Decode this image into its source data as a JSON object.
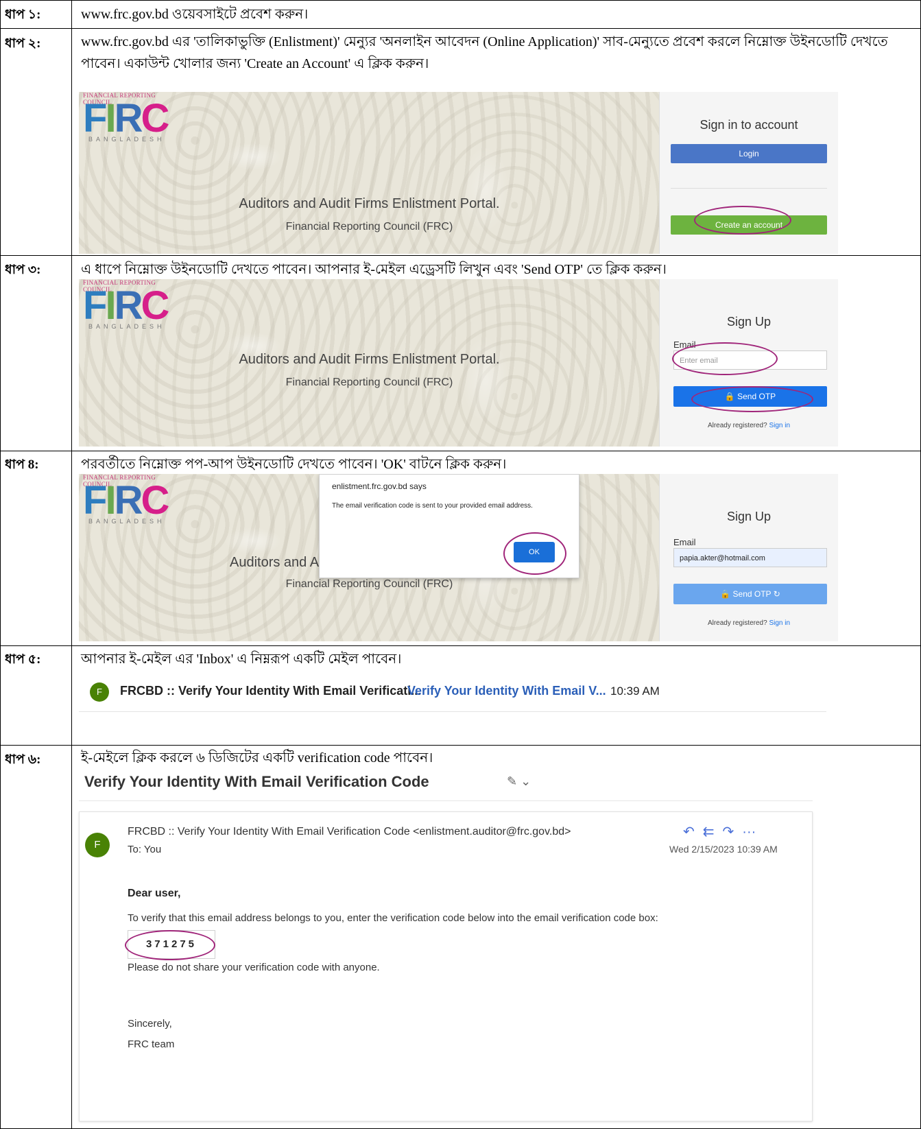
{
  "steps": [
    {
      "label": "ধাপ ১:",
      "text": "www.frc.gov.bd ওয়েবসাইটে প্রবেশ করুন।"
    },
    {
      "label": "ধাপ ২:",
      "text": "www.frc.gov.bd এর 'তালিকাভুক্তি (Enlistment)' মেন্যুর 'অনলাইন আবেদন (Online Application)' সাব-মেন্যুতে প্রবেশ করলে নিম্নোক্ত উইনডোটি দেখতে পাবেন। একাউন্ট খোলার জন্য 'Create an Account' এ ক্লিক করুন।"
    },
    {
      "label": "ধাপ ৩:",
      "text": "এ ধাপে নিম্নোক্ত উইনডোটি দেখতে পাবেন। আপনার ই-মেইল এড্রেসটি লিখুন এবং 'Send OTP' তে ক্লিক করুন।"
    },
    {
      "label": "ধাপ 8:",
      "text": "পরবর্তীতে নিম্নোক্ত পপ-আপ উইনডোটি দেখতে পাবেন। 'OK' বাটনে ক্লিক করুন।"
    },
    {
      "label": "ধাপ ৫:",
      "text": "আপনার ই-মেইল এর 'Inbox' এ নিম্নরূপ একটি মেইল পাবেন।"
    },
    {
      "label": "ধাপ ৬:",
      "text": "ই-মেইলে ক্লিক করলে ৬ ডিজিটের একটি verification code পাবেন।"
    }
  ],
  "logo": {
    "top_text": "FINANCIAL REPORTING COUNCIL",
    "mark": "FRC",
    "bottom_text": "BANGLADESH"
  },
  "portal": {
    "title": "Auditors and Audit Firms Enlistment Portal.",
    "title_cut": "Auditors and Aud",
    "subtitle": "Financial Reporting Council (FRC)",
    "signin_heading": "Sign in to account",
    "login_label": "Login",
    "create_label": "Create an account",
    "signup_heading": "Sign Up",
    "email_label": "Email",
    "email_placeholder": "Enter email",
    "email_value": "papia.akter@hotmail.com",
    "send_otp_label": "Send OTP",
    "already_text": "Already registered?",
    "signin_link": "Sign in"
  },
  "dialog": {
    "origin": "enlistment.frc.gov.bd says",
    "message": "The email verification code is sent to your provided email address.",
    "ok_label": "OK"
  },
  "inbox": {
    "avatar": "F",
    "sender_subject": "FRCBD :: Verify Your Identity With Email Verificati...",
    "preview": "Verify Your Identity With Email V...",
    "time": "10:39 AM"
  },
  "email": {
    "subject": "Verify Your Identity With Email Verification Code",
    "avatar": "F",
    "from": "FRCBD :: Verify Your Identity With Email Verification Code <enlistment.auditor@frc.gov.bd>",
    "to": "To:  You",
    "datetime": "Wed 2/15/2023 10:39 AM",
    "greeting": "Dear user,",
    "body1": "To verify that this email address belongs to you, enter the verification code below into the email verification code box:",
    "code": "371275",
    "body2": "Please do not share your verification code with anyone.",
    "closing": "Sincerely,",
    "signature": "FRC team"
  },
  "colors": {
    "accent_ring": "#a0257a",
    "login_blue": "#4a76c7",
    "create_green": "#6db33f",
    "otp_blue": "#1a73e8"
  }
}
